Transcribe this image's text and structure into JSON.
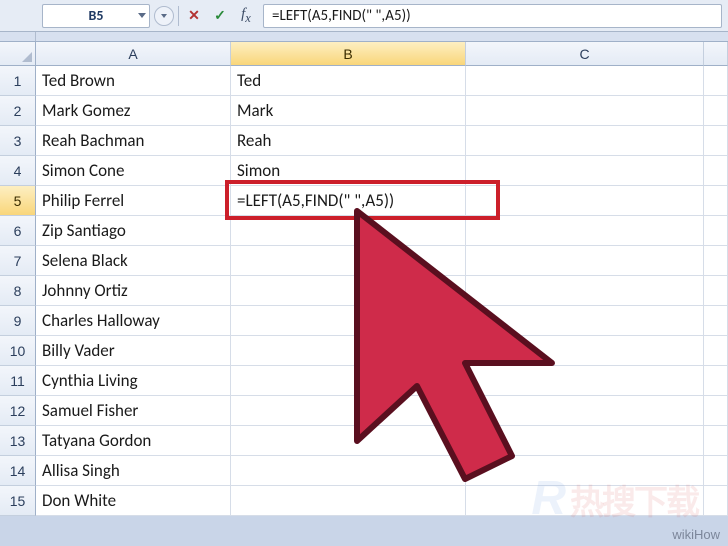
{
  "nameBox": "B5",
  "formula": "=LEFT(A5,FIND(\" \",A5))",
  "columns": [
    "A",
    "B",
    "C"
  ],
  "selectedColumn": "B",
  "selectedRow": 5,
  "rows": [
    {
      "n": 1,
      "a": "Ted Brown",
      "b": "Ted"
    },
    {
      "n": 2,
      "a": "Mark Gomez",
      "b": "Mark"
    },
    {
      "n": 3,
      "a": "Reah Bachman",
      "b": "Reah"
    },
    {
      "n": 4,
      "a": "Simon Cone",
      "b": "Simon"
    },
    {
      "n": 5,
      "a": "Philip Ferrel",
      "b": "=LEFT(A5,FIND(\" \",A5))"
    },
    {
      "n": 6,
      "a": "Zip Santiago",
      "b": ""
    },
    {
      "n": 7,
      "a": "Selena Black",
      "b": ""
    },
    {
      "n": 8,
      "a": "Johnny Ortiz",
      "b": ""
    },
    {
      "n": 9,
      "a": "Charles Halloway",
      "b": ""
    },
    {
      "n": 10,
      "a": "Billy Vader",
      "b": ""
    },
    {
      "n": 11,
      "a": "Cynthia Living",
      "b": ""
    },
    {
      "n": 12,
      "a": "Samuel Fisher",
      "b": ""
    },
    {
      "n": 13,
      "a": "Tatyana Gordon",
      "b": ""
    },
    {
      "n": 14,
      "a": "Allisa Singh",
      "b": ""
    },
    {
      "n": 15,
      "a": "Don White",
      "b": ""
    }
  ],
  "watermark": "wikiHow",
  "faintLogo": {
    "r": "R",
    "cn": "热搜下载"
  }
}
